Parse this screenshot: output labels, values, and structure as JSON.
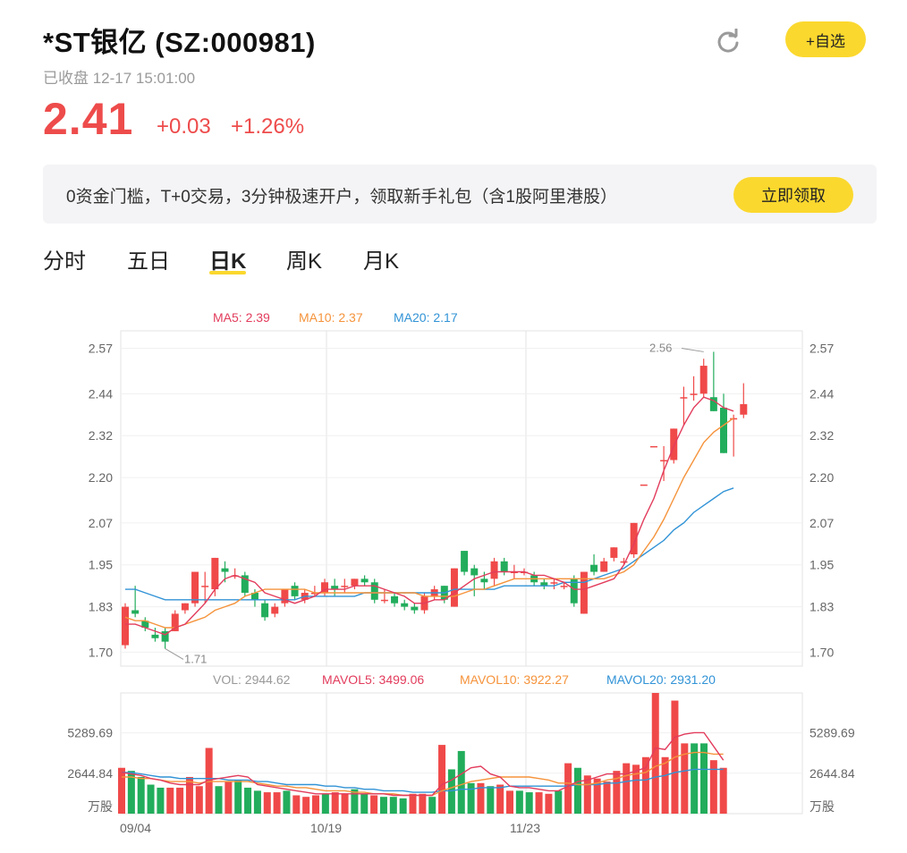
{
  "header": {
    "title": "*ST银亿 (SZ:000981)",
    "status": "已收盘 12-17 15:01:00",
    "price": "2.41",
    "change": "+0.03",
    "change_pct": "+1.26%",
    "follow_label": "+自选",
    "refresh_icon": "refresh-icon"
  },
  "banner": {
    "text": "0资金门槛，T+0交易，3分钟极速开户，领取新手礼包（含1股阿里港股）",
    "button_label": "立即领取"
  },
  "tabs": [
    "分时",
    "五日",
    "日K",
    "周K",
    "月K"
  ],
  "active_tab": "日K",
  "colors": {
    "up": "#f04949",
    "down": "#22ad5c",
    "ma5": "#e23c5c",
    "ma10": "#f5933b",
    "ma20": "#3193d6",
    "accent": "#fbd82e"
  },
  "chart_data": {
    "type": "candlestick",
    "ma_legend": [
      {
        "name": "MA5",
        "text": "MA5: 2.39"
      },
      {
        "name": "MA10",
        "text": "MA10: 2.37"
      },
      {
        "name": "MA20",
        "text": "MA20: 2.17"
      }
    ],
    "y_ticks": [
      "2.57",
      "2.44",
      "2.32",
      "2.20",
      "2.07",
      "1.95",
      "1.83",
      "1.70"
    ],
    "y_tick_values": [
      2.57,
      2.44,
      2.32,
      2.2,
      2.07,
      1.95,
      1.83,
      1.7
    ],
    "ylim": [
      1.66,
      2.62
    ],
    "high_label": "2.56",
    "low_label": "1.71",
    "x_labels": [
      {
        "text": "09/04",
        "index": 0
      },
      {
        "text": "10/19",
        "index": 20
      },
      {
        "text": "11/23",
        "index": 40
      }
    ],
    "candles": [
      {
        "o": 1.72,
        "c": 1.83,
        "h": 1.84,
        "l": 1.71
      },
      {
        "o": 1.82,
        "c": 1.81,
        "h": 1.89,
        "l": 1.8
      },
      {
        "o": 1.79,
        "c": 1.77,
        "h": 1.8,
        "l": 1.76
      },
      {
        "o": 1.75,
        "c": 1.74,
        "h": 1.77,
        "l": 1.73
      },
      {
        "o": 1.76,
        "c": 1.73,
        "h": 1.77,
        "l": 1.71
      },
      {
        "o": 1.76,
        "c": 1.81,
        "h": 1.82,
        "l": 1.76
      },
      {
        "o": 1.82,
        "c": 1.84,
        "h": 1.84,
        "l": 1.81
      },
      {
        "o": 1.84,
        "c": 1.93,
        "h": 1.93,
        "l": 1.83
      },
      {
        "o": 1.89,
        "c": 1.89,
        "h": 1.93,
        "l": 1.84
      },
      {
        "o": 1.88,
        "c": 1.97,
        "h": 1.97,
        "l": 1.86
      },
      {
        "o": 1.94,
        "c": 1.93,
        "h": 1.96,
        "l": 1.9
      },
      {
        "o": 1.92,
        "c": 1.92,
        "h": 1.94,
        "l": 1.91
      },
      {
        "o": 1.92,
        "c": 1.87,
        "h": 1.93,
        "l": 1.86
      },
      {
        "o": 1.87,
        "c": 1.85,
        "h": 1.88,
        "l": 1.83
      },
      {
        "o": 1.84,
        "c": 1.8,
        "h": 1.85,
        "l": 1.79
      },
      {
        "o": 1.81,
        "c": 1.83,
        "h": 1.84,
        "l": 1.8
      },
      {
        "o": 1.84,
        "c": 1.88,
        "h": 1.88,
        "l": 1.83
      },
      {
        "o": 1.89,
        "c": 1.86,
        "h": 1.9,
        "l": 1.85
      },
      {
        "o": 1.85,
        "c": 1.87,
        "h": 1.88,
        "l": 1.84
      },
      {
        "o": 1.87,
        "c": 1.87,
        "h": 1.89,
        "l": 1.86
      },
      {
        "o": 1.87,
        "c": 1.9,
        "h": 1.91,
        "l": 1.86
      },
      {
        "o": 1.89,
        "c": 1.88,
        "h": 1.91,
        "l": 1.86
      },
      {
        "o": 1.89,
        "c": 1.89,
        "h": 1.91,
        "l": 1.87
      },
      {
        "o": 1.89,
        "c": 1.91,
        "h": 1.91,
        "l": 1.88
      },
      {
        "o": 1.91,
        "c": 1.9,
        "h": 1.92,
        "l": 1.89
      },
      {
        "o": 1.9,
        "c": 1.85,
        "h": 1.91,
        "l": 1.84
      },
      {
        "o": 1.85,
        "c": 1.85,
        "h": 1.88,
        "l": 1.84
      },
      {
        "o": 1.86,
        "c": 1.84,
        "h": 1.87,
        "l": 1.83
      },
      {
        "o": 1.84,
        "c": 1.83,
        "h": 1.85,
        "l": 1.82
      },
      {
        "o": 1.83,
        "c": 1.82,
        "h": 1.84,
        "l": 1.81
      },
      {
        "o": 1.82,
        "c": 1.86,
        "h": 1.87,
        "l": 1.81
      },
      {
        "o": 1.86,
        "c": 1.88,
        "h": 1.89,
        "l": 1.85
      },
      {
        "o": 1.89,
        "c": 1.85,
        "h": 1.89,
        "l": 1.84
      },
      {
        "o": 1.83,
        "c": 1.94,
        "h": 1.94,
        "l": 1.83
      },
      {
        "o": 1.99,
        "c": 1.93,
        "h": 1.99,
        "l": 1.92
      },
      {
        "o": 1.94,
        "c": 1.92,
        "h": 1.95,
        "l": 1.86
      },
      {
        "o": 1.91,
        "c": 1.9,
        "h": 1.93,
        "l": 1.88
      },
      {
        "o": 1.91,
        "c": 1.96,
        "h": 1.97,
        "l": 1.89
      },
      {
        "o": 1.96,
        "c": 1.93,
        "h": 1.97,
        "l": 1.92
      },
      {
        "o": 1.93,
        "c": 1.93,
        "h": 1.95,
        "l": 1.91
      },
      {
        "o": 1.93,
        "c": 1.93,
        "h": 1.94,
        "l": 1.92
      }
    ],
    "candles_tail": [
      {
        "o": 1.92,
        "c": 1.9,
        "h": 1.93,
        "l": 1.89
      },
      {
        "o": 1.9,
        "c": 1.89,
        "h": 1.91,
        "l": 1.88
      },
      {
        "o": 1.9,
        "c": 1.9,
        "h": 1.91,
        "l": 1.88
      },
      {
        "o": 1.89,
        "c": 1.89,
        "h": 1.9,
        "l": 1.88
      },
      {
        "o": 1.91,
        "c": 1.84,
        "h": 1.92,
        "l": 1.83
      },
      {
        "o": 1.81,
        "c": 1.93,
        "h": 1.93,
        "l": 1.81
      },
      {
        "o": 1.95,
        "c": 1.93,
        "h": 1.98,
        "l": 1.92
      },
      {
        "o": 1.93,
        "c": 1.96,
        "h": 1.97,
        "l": 1.93
      },
      {
        "o": 1.97,
        "c": 2.0,
        "h": 2.0,
        "l": 1.96
      },
      {
        "o": 1.96,
        "c": 1.96,
        "h": 1.97,
        "l": 1.95
      },
      {
        "o": 1.98,
        "c": 2.07,
        "h": 2.07,
        "l": 1.97
      },
      {
        "o": 2.18,
        "c": 2.18,
        "h": 2.18,
        "l": 2.18
      },
      {
        "o": 2.29,
        "c": 2.29,
        "h": 2.29,
        "l": 2.29
      },
      {
        "o": 2.25,
        "c": 2.25,
        "h": 2.29,
        "l": 2.19
      },
      {
        "o": 2.25,
        "c": 2.34,
        "h": 2.34,
        "l": 2.24
      },
      {
        "o": 2.43,
        "c": 2.43,
        "h": 2.46,
        "l": 2.35
      },
      {
        "o": 2.44,
        "c": 2.44,
        "h": 2.49,
        "l": 2.42
      },
      {
        "o": 2.44,
        "c": 2.52,
        "h": 2.54,
        "l": 2.43
      },
      {
        "o": 2.43,
        "c": 2.39,
        "h": 2.56,
        "l": 2.39
      },
      {
        "o": 2.4,
        "c": 2.27,
        "h": 2.44,
        "l": 2.27
      },
      {
        "o": 2.37,
        "c": 2.37,
        "h": 2.38,
        "l": 2.26
      },
      {
        "o": 2.38,
        "c": 2.41,
        "h": 2.47,
        "l": 2.37
      }
    ],
    "ma5": [
      1.78,
      1.78,
      1.77,
      1.76,
      1.75,
      1.77,
      1.78,
      1.81,
      1.84,
      1.88,
      1.91,
      1.92,
      1.91,
      1.9,
      1.87,
      1.86,
      1.85,
      1.84,
      1.85,
      1.86,
      1.88,
      1.88,
      1.88,
      1.89,
      1.89,
      1.89,
      1.88,
      1.87,
      1.86,
      1.84,
      1.84,
      1.85,
      1.85,
      1.87,
      1.89,
      1.91,
      1.92,
      1.93,
      1.93,
      1.93,
      1.93,
      1.92,
      1.92,
      1.91,
      1.9,
      1.88,
      1.88,
      1.89,
      1.9,
      1.91,
      1.95,
      2.01,
      2.08,
      2.14,
      2.22,
      2.29,
      2.35,
      2.4,
      2.43,
      2.42,
      2.4,
      2.39
    ],
    "ma10": [
      1.8,
      1.79,
      1.79,
      1.78,
      1.77,
      1.77,
      1.78,
      1.79,
      1.8,
      1.82,
      1.83,
      1.84,
      1.86,
      1.87,
      1.88,
      1.88,
      1.88,
      1.88,
      1.88,
      1.87,
      1.87,
      1.87,
      1.87,
      1.87,
      1.87,
      1.87,
      1.87,
      1.87,
      1.87,
      1.87,
      1.86,
      1.86,
      1.86,
      1.86,
      1.87,
      1.88,
      1.88,
      1.89,
      1.9,
      1.91,
      1.91,
      1.91,
      1.91,
      1.91,
      1.91,
      1.91,
      1.91,
      1.91,
      1.91,
      1.92,
      1.93,
      1.95,
      1.99,
      2.03,
      2.08,
      2.14,
      2.2,
      2.25,
      2.3,
      2.33,
      2.35,
      2.37
    ],
    "ma20": [
      1.88,
      1.88,
      1.87,
      1.86,
      1.85,
      1.85,
      1.85,
      1.85,
      1.85,
      1.85,
      1.85,
      1.85,
      1.85,
      1.85,
      1.85,
      1.85,
      1.85,
      1.85,
      1.86,
      1.86,
      1.86,
      1.86,
      1.86,
      1.86,
      1.87,
      1.87,
      1.87,
      1.87,
      1.87,
      1.87,
      1.87,
      1.87,
      1.87,
      1.88,
      1.88,
      1.88,
      1.88,
      1.88,
      1.89,
      1.89,
      1.89,
      1.89,
      1.89,
      1.89,
      1.9,
      1.9,
      1.9,
      1.91,
      1.92,
      1.93,
      1.94,
      1.96,
      1.98,
      2.0,
      2.02,
      2.05,
      2.07,
      2.1,
      2.12,
      2.14,
      2.16,
      2.17
    ],
    "vol_legend": {
      "vol": "VOL: 2944.62",
      "mavol5": "MAVOL5: 3499.06",
      "mavol10": "MAVOL10: 3922.27",
      "mavol20": "MAVOL20: 2931.20"
    },
    "vol_ticks": [
      "5289.69",
      "2644.84",
      "万股"
    ],
    "vol_tick_values": [
      5289.69,
      2644.84
    ],
    "vol_max": 7900,
    "volume": [
      3000,
      2800,
      2400,
      1900,
      1700,
      1700,
      1700,
      2400,
      1800,
      4300,
      1800,
      2100,
      2200,
      1700,
      1500,
      1400,
      1400,
      1500,
      1200,
      1100,
      1200,
      1300,
      1400,
      1300,
      1600,
      1300,
      1200,
      1100,
      1100,
      1000,
      1300,
      1300,
      1100,
      4500,
      2900,
      4100,
      2000,
      2000,
      1800,
      1900,
      1500,
      1500,
      1400,
      1400,
      1300,
      1500,
      3300,
      3000,
      2500,
      2300,
      2100,
      2800,
      3300,
      3200,
      3700,
      7900,
      3700,
      7400,
      4600,
      4600,
      4600,
      3500,
      3000
    ],
    "mavol5": [
      2700,
      2600,
      2500,
      2300,
      2200,
      2000,
      1900,
      1900,
      1900,
      2200,
      2300,
      2400,
      2500,
      2400,
      1900,
      1800,
      1700,
      1600,
      1500,
      1400,
      1300,
      1300,
      1300,
      1300,
      1300,
      1300,
      1300,
      1300,
      1200,
      1200,
      1200,
      1200,
      1200,
      1900,
      2200,
      2600,
      3000,
      3100,
      2600,
      2400,
      1800,
      1700,
      1700,
      1600,
      1500,
      1500,
      1800,
      2100,
      2200,
      2400,
      2600,
      2600,
      2600,
      2800,
      3000,
      4300,
      4200,
      5000,
      5200,
      5300,
      5300,
      4400,
      3500
    ],
    "mavol10": [
      2400,
      2400,
      2300,
      2300,
      2200,
      2100,
      2100,
      2100,
      2000,
      2100,
      2100,
      2100,
      2100,
      2100,
      2000,
      1900,
      1800,
      1800,
      1700,
      1700,
      1600,
      1500,
      1500,
      1500,
      1400,
      1400,
      1300,
      1300,
      1300,
      1200,
      1200,
      1200,
      1200,
      1500,
      1700,
      1900,
      2100,
      2200,
      2300,
      2400,
      2400,
      2400,
      2400,
      2300,
      2200,
      2000,
      2000,
      1900,
      1900,
      2000,
      2200,
      2300,
      2500,
      2600,
      2700,
      3100,
      3300,
      3700,
      3900,
      4000,
      4000,
      3900,
      3900
    ],
    "mavol20": [
      2700,
      2700,
      2600,
      2500,
      2400,
      2400,
      2300,
      2300,
      2300,
      2300,
      2300,
      2200,
      2200,
      2200,
      2100,
      2100,
      2000,
      1900,
      1900,
      1900,
      1900,
      1800,
      1800,
      1700,
      1700,
      1600,
      1600,
      1500,
      1500,
      1500,
      1400,
      1400,
      1400,
      1500,
      1500,
      1600,
      1600,
      1700,
      1700,
      1700,
      1800,
      1800,
      1800,
      1800,
      1800,
      1800,
      1800,
      1900,
      1900,
      1900,
      2000,
      2000,
      2100,
      2200,
      2200,
      2400,
      2500,
      2700,
      2800,
      2900,
      2900,
      2900,
      2900
    ]
  }
}
